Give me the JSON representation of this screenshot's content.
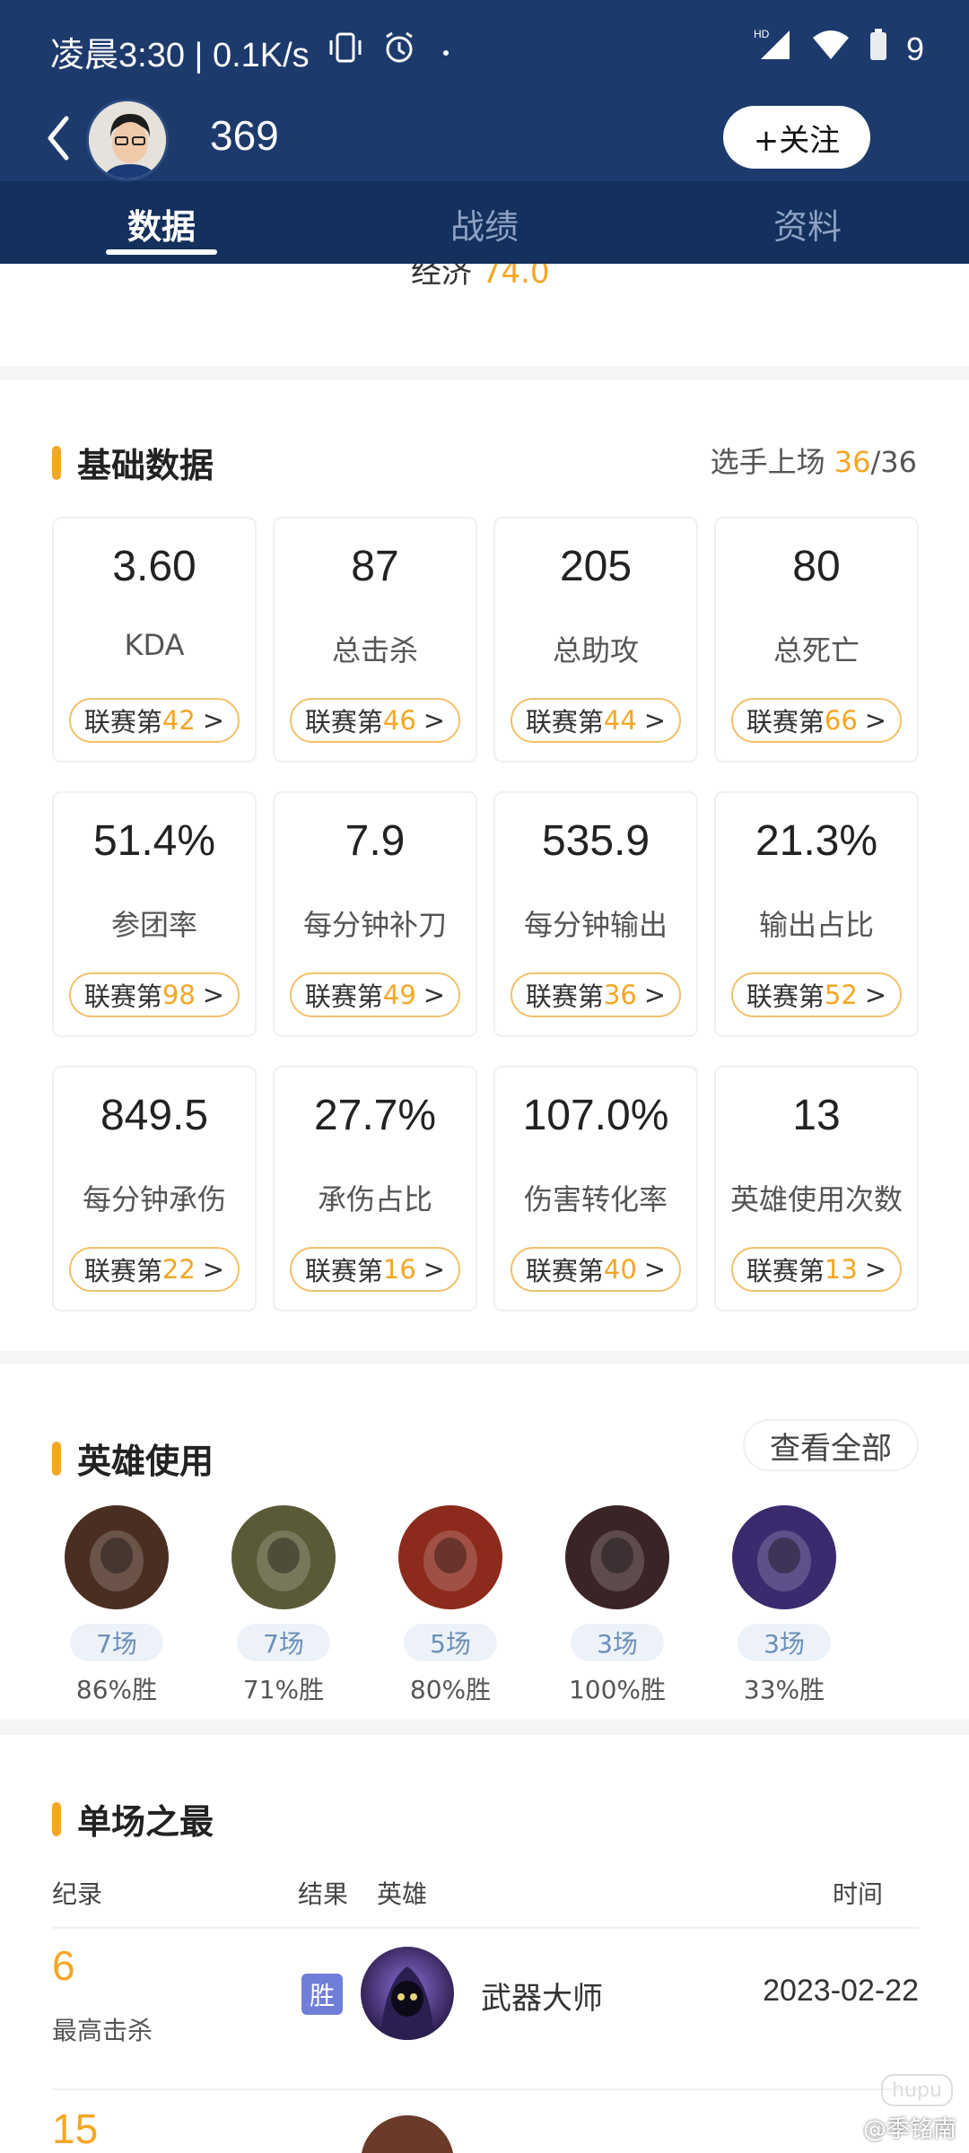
{
  "status_bar": {
    "time": "凌晨3:30 | 0.1K/s",
    "battery": "9",
    "icons": [
      "vibrate-icon",
      "alarm-icon",
      "signal-hd-icon",
      "wifi-icon",
      "battery-icon"
    ]
  },
  "header": {
    "player_name": "369",
    "follow_label": "+关注"
  },
  "tabs": [
    {
      "label": "数据",
      "active": true
    },
    {
      "label": "战绩",
      "active": false
    },
    {
      "label": "资料",
      "active": false
    }
  ],
  "partial": {
    "label": "经济",
    "value": "74.0"
  },
  "basic": {
    "title": "基础数据",
    "games_label": "选手上场",
    "games_played": "36",
    "games_total": "/36",
    "rank_prefix": "联赛第",
    "rank_arrow": ">",
    "stats": [
      {
        "value": "3.60",
        "label": "KDA",
        "rank": "42"
      },
      {
        "value": "87",
        "label": "总击杀",
        "rank": "46"
      },
      {
        "value": "205",
        "label": "总助攻",
        "rank": "44"
      },
      {
        "value": "80",
        "label": "总死亡",
        "rank": "66"
      },
      {
        "value": "51.4%",
        "label": "参团率",
        "rank": "98"
      },
      {
        "value": "7.9",
        "label": "每分钟补刀",
        "rank": "49"
      },
      {
        "value": "535.9",
        "label": "每分钟输出",
        "rank": "36"
      },
      {
        "value": "21.3%",
        "label": "输出占比",
        "rank": "52"
      },
      {
        "value": "849.5",
        "label": "每分钟承伤",
        "rank": "22"
      },
      {
        "value": "27.7%",
        "label": "承伤占比",
        "rank": "16"
      },
      {
        "value": "107.0%",
        "label": "伤害转化率",
        "rank": "40"
      },
      {
        "value": "13",
        "label": "英雄使用次数",
        "rank": "13"
      }
    ]
  },
  "heroes": {
    "title": "英雄使用",
    "view_all": "查看全部",
    "list": [
      {
        "games": "7场",
        "win": "86%胜",
        "color": "#4a2e22"
      },
      {
        "games": "7场",
        "win": "71%胜",
        "color": "#5b5a36"
      },
      {
        "games": "5场",
        "win": "80%胜",
        "color": "#8c2a1c"
      },
      {
        "games": "3场",
        "win": "100%胜",
        "color": "#3a2426"
      },
      {
        "games": "3场",
        "win": "33%胜",
        "color": "#3b2a6e"
      }
    ]
  },
  "best": {
    "title": "单场之最",
    "col_record": "纪录",
    "col_result": "结果",
    "col_hero": "英雄",
    "col_time": "时间",
    "row": {
      "number": "6",
      "record": "最高击杀",
      "result": "胜",
      "hero": "武器大师",
      "date": "2023-02-22"
    },
    "next_number": "15"
  },
  "watermark": {
    "logo": "hupu",
    "text": "@季铭南"
  }
}
